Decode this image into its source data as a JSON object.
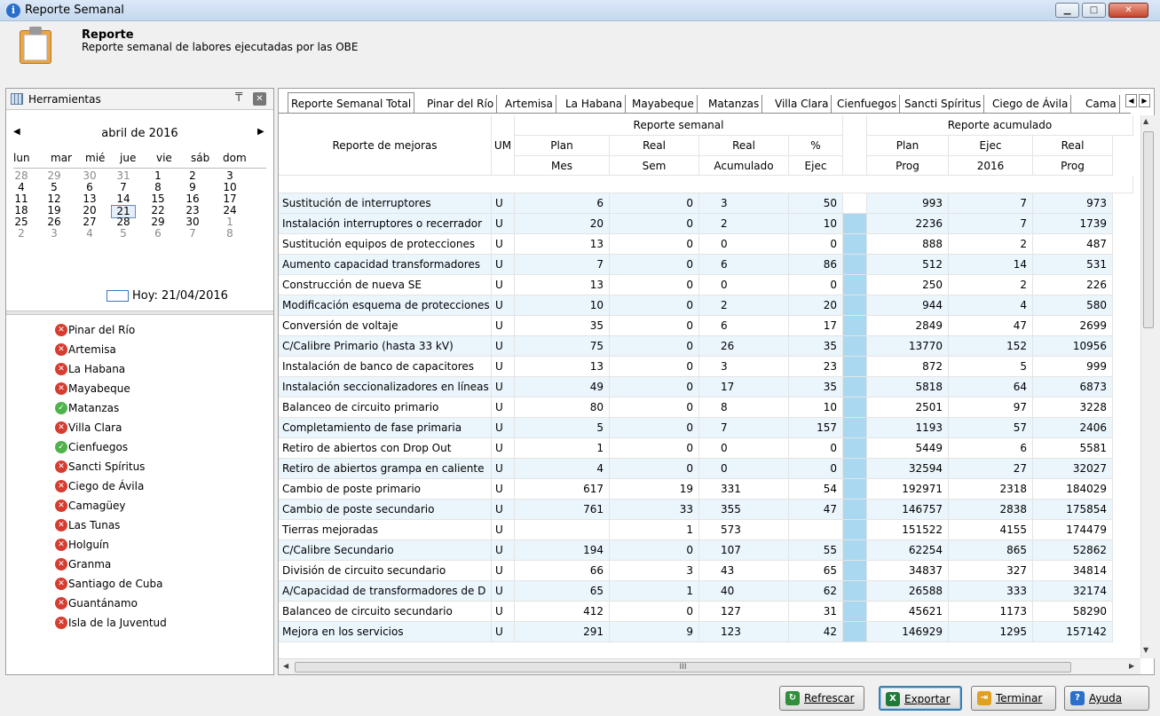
{
  "window": {
    "title": "Reporte Semanal",
    "info_icon": "info-icon"
  },
  "header": {
    "title": "Reporte",
    "subtitle": "Reporte semanal de labores ejecutadas por las OBE"
  },
  "tools": {
    "label": "Herramientas",
    "pin": "pin-icon",
    "close": "close-icon"
  },
  "calendar": {
    "month": "abril de 2016",
    "weekdays": [
      "lun",
      "mar",
      "mié",
      "jue",
      "vie",
      "sáb",
      "dom"
    ],
    "weeks": [
      [
        "28",
        "29",
        "30",
        "31",
        "1",
        "2",
        "3"
      ],
      [
        "4",
        "5",
        "6",
        "7",
        "8",
        "9",
        "10"
      ],
      [
        "11",
        "12",
        "13",
        "14",
        "15",
        "16",
        "17"
      ],
      [
        "18",
        "19",
        "20",
        "21",
        "22",
        "23",
        "24"
      ],
      [
        "25",
        "26",
        "27",
        "28",
        "29",
        "30",
        "1"
      ],
      [
        "2",
        "3",
        "4",
        "5",
        "6",
        "7",
        "8"
      ]
    ],
    "selected": "21",
    "today": "Hoy: 21/04/2016"
  },
  "provinces": [
    {
      "name": "Pinar del Río",
      "status": "error"
    },
    {
      "name": "Artemisa",
      "status": "error"
    },
    {
      "name": "La Habana",
      "status": "error"
    },
    {
      "name": "Mayabeque",
      "status": "error"
    },
    {
      "name": "Matanzas",
      "status": "ok"
    },
    {
      "name": "Villa Clara",
      "status": "error"
    },
    {
      "name": "Cienfuegos",
      "status": "ok"
    },
    {
      "name": "Sancti Spíritus",
      "status": "error"
    },
    {
      "name": "Ciego de Ávila",
      "status": "error"
    },
    {
      "name": "Camagüey",
      "status": "error"
    },
    {
      "name": "Las Tunas",
      "status": "error"
    },
    {
      "name": "Holguín",
      "status": "error"
    },
    {
      "name": "Granma",
      "status": "error"
    },
    {
      "name": "Santiago de Cuba",
      "status": "error"
    },
    {
      "name": "Guantánamo",
      "status": "error"
    },
    {
      "name": "Isla de la Juventud",
      "status": "error"
    }
  ],
  "tabs": [
    "Reporte Semanal Total",
    "Pinar del Río",
    "Artemisa",
    "La Habana",
    "Mayabeque",
    "Matanzas",
    "Villa Clara",
    "Cienfuegos",
    "Sancti Spíritus",
    "Ciego de Ávila",
    "Cama"
  ],
  "grid": {
    "group_semanal": "Reporte semanal",
    "group_acumulado": "Reporte acumulado",
    "col_label": "Reporte de mejoras",
    "col_um": "UM",
    "headers_top": [
      "Plan",
      "Real",
      "Real",
      "%",
      "",
      "Plan",
      "Ejec",
      "Real"
    ],
    "headers_bottom": [
      "Mes",
      "Sem",
      "Acumulado",
      "Ejec",
      "",
      "Prog",
      "2016",
      "Prog"
    ],
    "rows": [
      {
        "name": "Sustitución de interruptores",
        "um": "U",
        "v": [
          "6",
          "0",
          "3",
          "50",
          "993",
          "7",
          "973"
        ]
      },
      {
        "name": "Instalación interruptores o recerrador",
        "um": "U",
        "v": [
          "20",
          "0",
          "2",
          "10",
          "2236",
          "7",
          "1739"
        ]
      },
      {
        "name": "Sustitución equipos de protecciones",
        "um": "U",
        "v": [
          "13",
          "0",
          "0",
          "0",
          "888",
          "2",
          "487"
        ]
      },
      {
        "name": "Aumento capacidad transformadores",
        "um": "U",
        "v": [
          "7",
          "0",
          "6",
          "86",
          "512",
          "14",
          "531"
        ]
      },
      {
        "name": "Construcción de nueva SE",
        "um": "U",
        "v": [
          "13",
          "0",
          "0",
          "0",
          "250",
          "2",
          "226"
        ]
      },
      {
        "name": "Modificación esquema de protecciones",
        "um": "U",
        "v": [
          "10",
          "0",
          "2",
          "20",
          "944",
          "4",
          "580"
        ]
      },
      {
        "name": "Conversión de voltaje",
        "um": "U",
        "v": [
          "35",
          "0",
          "6",
          "17",
          "2849",
          "47",
          "2699"
        ]
      },
      {
        "name": "C/Calibre Primario (hasta 33 kV)",
        "um": "U",
        "v": [
          "75",
          "0",
          "26",
          "35",
          "13770",
          "152",
          "10956"
        ]
      },
      {
        "name": "Instalación de banco de capacitores",
        "um": "U",
        "v": [
          "13",
          "0",
          "3",
          "23",
          "872",
          "5",
          "999"
        ]
      },
      {
        "name": "Instalación seccionalizadores en líneas",
        "um": "U",
        "v": [
          "49",
          "0",
          "17",
          "35",
          "5818",
          "64",
          "6873"
        ]
      },
      {
        "name": "Balanceo de circuito primario",
        "um": "U",
        "v": [
          "80",
          "0",
          "8",
          "10",
          "2501",
          "97",
          "3228"
        ]
      },
      {
        "name": "Completamiento de fase primaria",
        "um": "U",
        "v": [
          "5",
          "0",
          "7",
          "157",
          "1193",
          "57",
          "2406"
        ]
      },
      {
        "name": "Retiro de abiertos con Drop Out",
        "um": "U",
        "v": [
          "1",
          "0",
          "0",
          "0",
          "5449",
          "6",
          "5581"
        ]
      },
      {
        "name": "Retiro de abiertos grampa en caliente",
        "um": "U",
        "v": [
          "4",
          "0",
          "0",
          "0",
          "32594",
          "27",
          "32027"
        ]
      },
      {
        "name": "Cambio de poste primario",
        "um": "U",
        "v": [
          "617",
          "19",
          "331",
          "54",
          "192971",
          "2318",
          "184029"
        ]
      },
      {
        "name": "Cambio de poste secundario",
        "um": "U",
        "v": [
          "761",
          "33",
          "355",
          "47",
          "146757",
          "2838",
          "175854"
        ]
      },
      {
        "name": "Tierras mejoradas",
        "um": "U",
        "v": [
          "",
          "1",
          "573",
          "",
          "151522",
          "4155",
          "174479"
        ]
      },
      {
        "name": "C/Calibre Secundario",
        "um": "U",
        "v": [
          "194",
          "0",
          "107",
          "55",
          "62254",
          "865",
          "52862"
        ]
      },
      {
        "name": "División de circuito secundario",
        "um": "U",
        "v": [
          "66",
          "3",
          "43",
          "65",
          "34837",
          "327",
          "34814"
        ]
      },
      {
        "name": "A/Capacidad de transformadores de D",
        "um": "U",
        "v": [
          "65",
          "1",
          "40",
          "62",
          "26588",
          "333",
          "32174"
        ]
      },
      {
        "name": "Balanceo de circuito secundario",
        "um": "U",
        "v": [
          "412",
          "0",
          "127",
          "31",
          "45621",
          "1173",
          "58290"
        ]
      },
      {
        "name": "Mejora en los servicios",
        "um": "U",
        "v": [
          "291",
          "9",
          "123",
          "42",
          "146929",
          "1295",
          "157142"
        ]
      }
    ]
  },
  "hscroll_label": "III",
  "buttons": [
    {
      "label": "Refrescar",
      "icon": "refresh-icon",
      "color": "#2f8f3a"
    },
    {
      "label": "Exportar",
      "icon": "excel-icon",
      "color": "#1f7a3a"
    },
    {
      "label": "Terminar",
      "icon": "exit-icon",
      "color": "#e0a020"
    },
    {
      "label": "Ayuda",
      "icon": "help-icon",
      "color": "#2a6fc9"
    }
  ]
}
